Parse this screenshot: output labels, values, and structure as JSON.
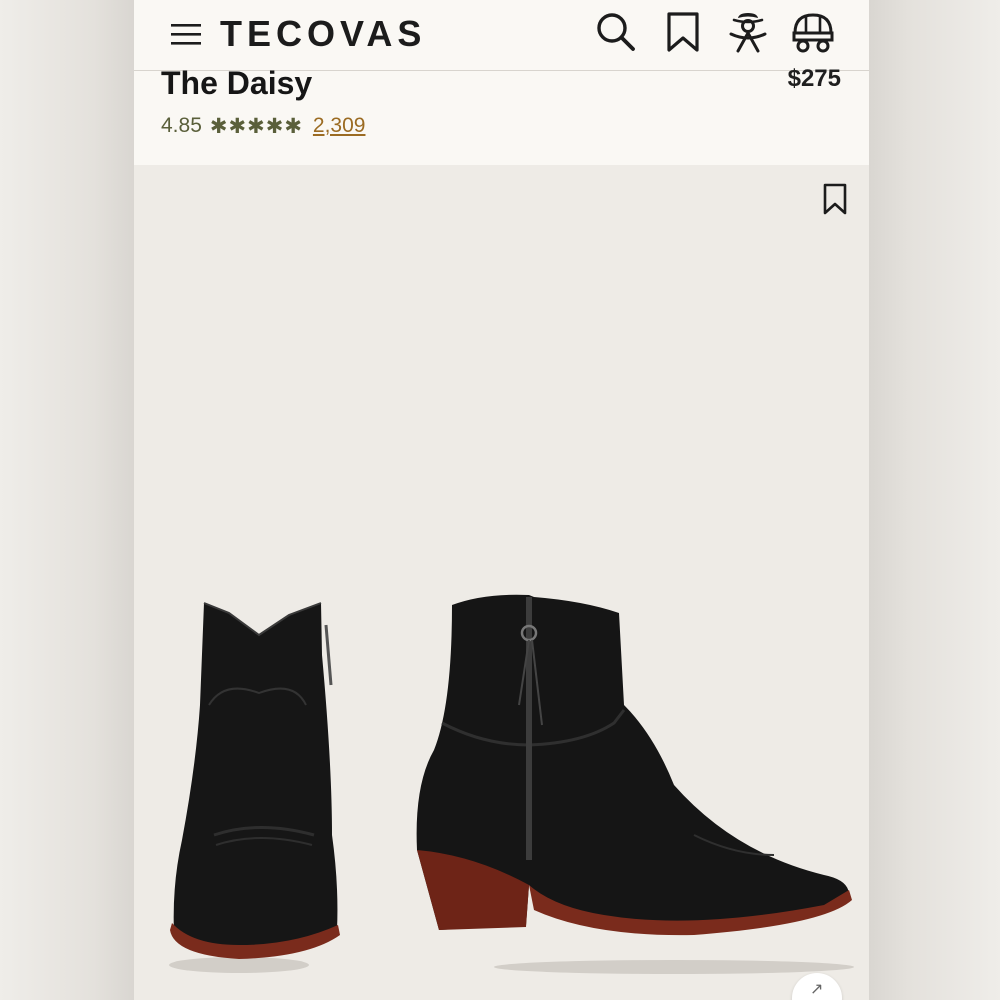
{
  "header": {
    "logo": "TECOVAS",
    "icons": [
      "menu-icon",
      "search-icon",
      "bookmark-icon",
      "account-icon",
      "cart-wagon-icon"
    ]
  },
  "product": {
    "title": "The Daisy",
    "price": "$275",
    "rating": "4.85",
    "stars": [
      "✱",
      "✱",
      "✱",
      "✱",
      "✱"
    ],
    "review_count": "2,309"
  },
  "gallery": {
    "wishlist_icon": "bookmark-icon",
    "expand_icon": "arrow-up-right-icon",
    "expand_glyph": "↗"
  },
  "colors": {
    "brand_dark": "#1c1c1c",
    "rating_green": "#5a5f3a",
    "review_link": "#9b6b22",
    "header_bg": "#faf8f4"
  }
}
